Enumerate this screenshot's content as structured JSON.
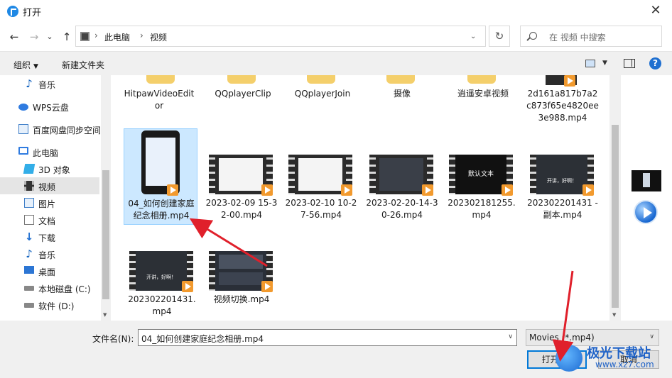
{
  "window": {
    "title": "打开",
    "close_glyph": "✕"
  },
  "nav": {
    "back": "←",
    "forward": "→",
    "dropdown": "⌄",
    "up": "↑",
    "refresh": "↻"
  },
  "breadcrumb": [
    "此电脑",
    "视频"
  ],
  "breadcrumb_sep": "›",
  "search": {
    "placeholder": "在 视频 中搜索"
  },
  "toolbar": {
    "organize": "组织",
    "new_folder": "新建文件夹",
    "caret": "▼",
    "help": "?"
  },
  "sidebar": {
    "items": [
      {
        "label": "音乐",
        "icon": "music-icon"
      },
      {
        "label": "WPS云盘",
        "icon": "cloud-icon"
      },
      {
        "label": "百度网盘同步空间",
        "icon": "baidu-sync-icon"
      },
      {
        "label": "此电脑",
        "icon": "computer-icon"
      },
      {
        "label": "3D 对象",
        "icon": "3d-objects-icon"
      },
      {
        "label": "视频",
        "icon": "video-folder-icon",
        "selected": true
      },
      {
        "label": "图片",
        "icon": "pictures-icon"
      },
      {
        "label": "文档",
        "icon": "documents-icon"
      },
      {
        "label": "下载",
        "icon": "download-icon"
      },
      {
        "label": "音乐",
        "icon": "music-icon"
      },
      {
        "label": "桌面",
        "icon": "desktop-icon"
      },
      {
        "label": "本地磁盘 (C:)",
        "icon": "drive-icon"
      },
      {
        "label": "软件 (D:)",
        "icon": "drive-icon"
      }
    ]
  },
  "files": {
    "row1": [
      {
        "label": "HitpawVideoEditor",
        "type": "folder"
      },
      {
        "label": "QQplayerClip",
        "type": "folder"
      },
      {
        "label": "QQplayerJoin",
        "type": "folder"
      },
      {
        "label": "摄像",
        "type": "folder"
      },
      {
        "label": "逍遥安卓视频",
        "type": "folder"
      },
      {
        "label": "2d161a817b7a2c873f65e4820ee3e988.mp4",
        "type": "video"
      }
    ],
    "row2": [
      {
        "label": "04_如何创建家庭纪念相册.mp4",
        "type": "video",
        "selected": true
      },
      {
        "label": "2023-02-09 15-32-00.mp4",
        "type": "video"
      },
      {
        "label": "2023-02-10 10-27-56.mp4",
        "type": "video"
      },
      {
        "label": "2023-02-20-14-30-26.mp4",
        "type": "video"
      },
      {
        "label": "202302181255.mp4",
        "type": "video",
        "thumb_text": "默认文本"
      },
      {
        "label": "202302201431 - 副本.mp4",
        "type": "video",
        "thumb_text": "开讲，好啊！"
      }
    ],
    "row3": [
      {
        "label": "202302201431.mp4",
        "type": "video",
        "thumb_text": "开讲，好啊！"
      },
      {
        "label": "视频切换.mp4",
        "type": "video"
      }
    ]
  },
  "bottom": {
    "filename_label": "文件名(N):",
    "filename_value": "04_如何创建家庭纪念相册.mp4",
    "filetype_value": "Movies (*.mp4)",
    "open_button": "打开(O)",
    "cancel_button": "取消",
    "caret": "∨"
  },
  "watermark": {
    "title": "极光下载站",
    "url": "www.xz7.com"
  },
  "colors": {
    "accent": "#0078d7",
    "arrow": "#e0202b",
    "selection": "#cce8ff"
  }
}
